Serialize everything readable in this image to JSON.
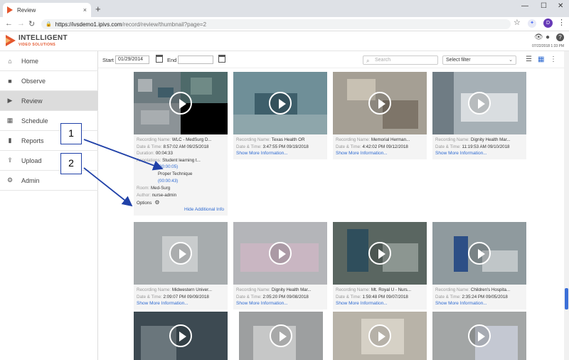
{
  "browser": {
    "tab_title": "Review",
    "tab_close": "×",
    "new_tab": "+",
    "window_controls": [
      "—",
      "☐",
      "✕"
    ],
    "url_host": "https://ivsdemo1.ipivs.com",
    "url_path": "/record/review/thumbnail?page=2",
    "profile_initial": "D"
  },
  "header": {
    "brand_top": "INTELLIGENT",
    "brand_bottom": "VIDEO SOLUTIONS",
    "datetime": "07/22/2018 1:33 PM"
  },
  "sidebar": {
    "items": [
      {
        "label": "Home",
        "icon": "home-icon"
      },
      {
        "label": "Observe",
        "icon": "video-camera-icon"
      },
      {
        "label": "Review",
        "icon": "play-circle-icon"
      },
      {
        "label": "Schedule",
        "icon": "calendar-icon"
      },
      {
        "label": "Reports",
        "icon": "bar-chart-icon"
      },
      {
        "label": "Upload",
        "icon": "upload-icon"
      },
      {
        "label": "Admin",
        "icon": "gear-icon"
      }
    ],
    "active": "Review"
  },
  "toolbar": {
    "start_label": "Start",
    "start_value": "01/29/2014",
    "end_label": "End",
    "end_value": "",
    "search_placeholder": "Search",
    "filter_value": "Select filter"
  },
  "labels": {
    "recording_name": "Recording Name:",
    "date_time": "Date & Time:",
    "duration": "Duration:",
    "annotations": "Annotations:",
    "room": "Room:",
    "author": "Author:",
    "options": "Options",
    "show_more": "Show More Information...",
    "hide_info": "Hide Additional Info"
  },
  "expanded": {
    "name": "WLC - MedSurg D...",
    "datetime": "8:57:02 AM 09/25/2018",
    "duration": "00:04:33",
    "annotation1": "Student learning t...",
    "annotation1_time": "(00:00:05)",
    "annotation2": "Proper Technique",
    "annotation2_time": "(00:00:43)",
    "room": "Med-Surg",
    "author": "nurse-admin"
  },
  "recordings": [
    {
      "name": "Texas Health OR",
      "datetime": "3:47:55 PM 09/19/2018",
      "thumb": "#5d7d86"
    },
    {
      "name": "Memorial Herman...",
      "datetime": "4:42:02 PM 09/12/2018",
      "thumb": "#8f8a80"
    },
    {
      "name": "Dignity Health Mar...",
      "datetime": "11:19:53 AM 09/10/2018",
      "thumb": "#8e9aa2"
    },
    {
      "name": "Midwestern Univer...",
      "datetime": "2:09:07 PM 09/09/2018",
      "thumb": "#9aa0a2"
    },
    {
      "name": "Dignity Health Mar...",
      "datetime": "2:05:20 PM 09/08/2018",
      "thumb": "#a7a8ad"
    },
    {
      "name": "Mt. Royal U - Nurs...",
      "datetime": "1:59:48 PM 09/07/2018",
      "thumb": "#5a6661"
    },
    {
      "name": "Children's Hospita...",
      "datetime": "2:35:24 PM 09/05/2018",
      "thumb": "#8f9a9e"
    }
  ],
  "bottom_thumbs": [
    "#3d4a52",
    "#9d9fa0",
    "#b8b3a8",
    "#a3a6a6"
  ],
  "callouts": [
    "1",
    "2"
  ]
}
